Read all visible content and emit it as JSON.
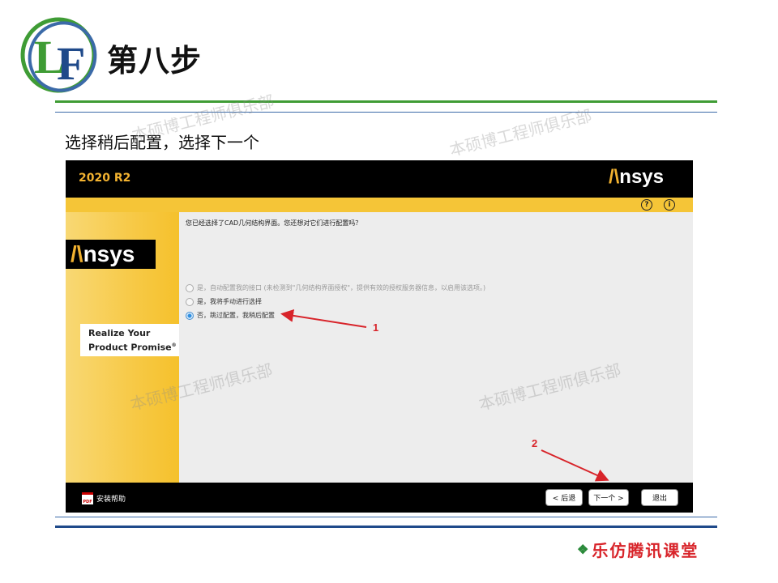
{
  "slide": {
    "title": "第八步",
    "subtitle": "选择稍后配置，选择下一个",
    "watermark": "本硕博工程师俱乐部",
    "footer_brand": "乐仿腾讯课堂",
    "colors": {
      "green": "#3f9c35",
      "blue": "#1f4a8a",
      "red": "#d8242a"
    }
  },
  "installer": {
    "version": "2020 R2",
    "brand": {
      "mark": "/\\",
      "rest": "nsys"
    },
    "slogan": {
      "line1": "Realize Your",
      "line2": "Product Promise",
      "mark": "®"
    },
    "toolbar": {
      "help_icon": "?",
      "info_icon": "i"
    },
    "question": "您已经选择了CAD几何结构界面。您还想对它们进行配置吗？",
    "options": [
      {
        "label": "是，自动配置我的接口 (未检测到\"几何结构界面授权\"，提供有效的授权服务器信息，以启用该选项。)",
        "selected": false,
        "disabled": true
      },
      {
        "label": "是，我将手动进行选择",
        "selected": false,
        "disabled": false
      },
      {
        "label": "否，跳过配置，我稍后配置",
        "selected": true,
        "disabled": false
      }
    ],
    "footer": {
      "help_label": "安装帮助",
      "pdf_label": "PDF",
      "back_label": "< 后退",
      "next_label": "下一个 >",
      "exit_label": "退出"
    }
  },
  "annotations": {
    "one": "1",
    "two": "2"
  }
}
